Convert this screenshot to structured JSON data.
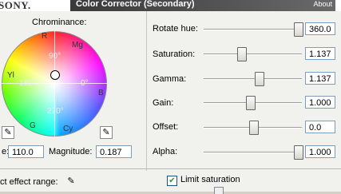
{
  "header": {
    "logo": "SONY.",
    "title": "Color Corrector (Secondary)",
    "about": "About"
  },
  "wheel": {
    "title": "Chrominance:",
    "labels": {
      "r": "R",
      "mg": "Mg",
      "yl": "Yl",
      "b": "B",
      "g": "G",
      "cy": "Cy"
    },
    "degrees": {
      "d90": "90°",
      "d180": "180°",
      "d0": "0°",
      "d270": "270°"
    }
  },
  "angle": {
    "label": "e:",
    "value": "110.0"
  },
  "magnitude": {
    "label": "Magnitude:",
    "value": "0.187"
  },
  "sliders": [
    {
      "label": "Rotate hue:",
      "value": "360.0",
      "fraction": 1.0
    },
    {
      "label": "Saturation:",
      "value": "1.137",
      "fraction": 0.37
    },
    {
      "label": "Gamma:",
      "value": "1.137",
      "fraction": 0.57
    },
    {
      "label": "Gain:",
      "value": "1.000",
      "fraction": 0.47
    },
    {
      "label": "Offset:",
      "value": "0.0",
      "fraction": 0.5
    },
    {
      "label": "Alpha:",
      "value": "1.000",
      "fraction": 1.0
    }
  ],
  "effect_range": {
    "label": "ct effect range:"
  },
  "limit_saturation": {
    "label": "Limit saturation",
    "checked": true
  }
}
